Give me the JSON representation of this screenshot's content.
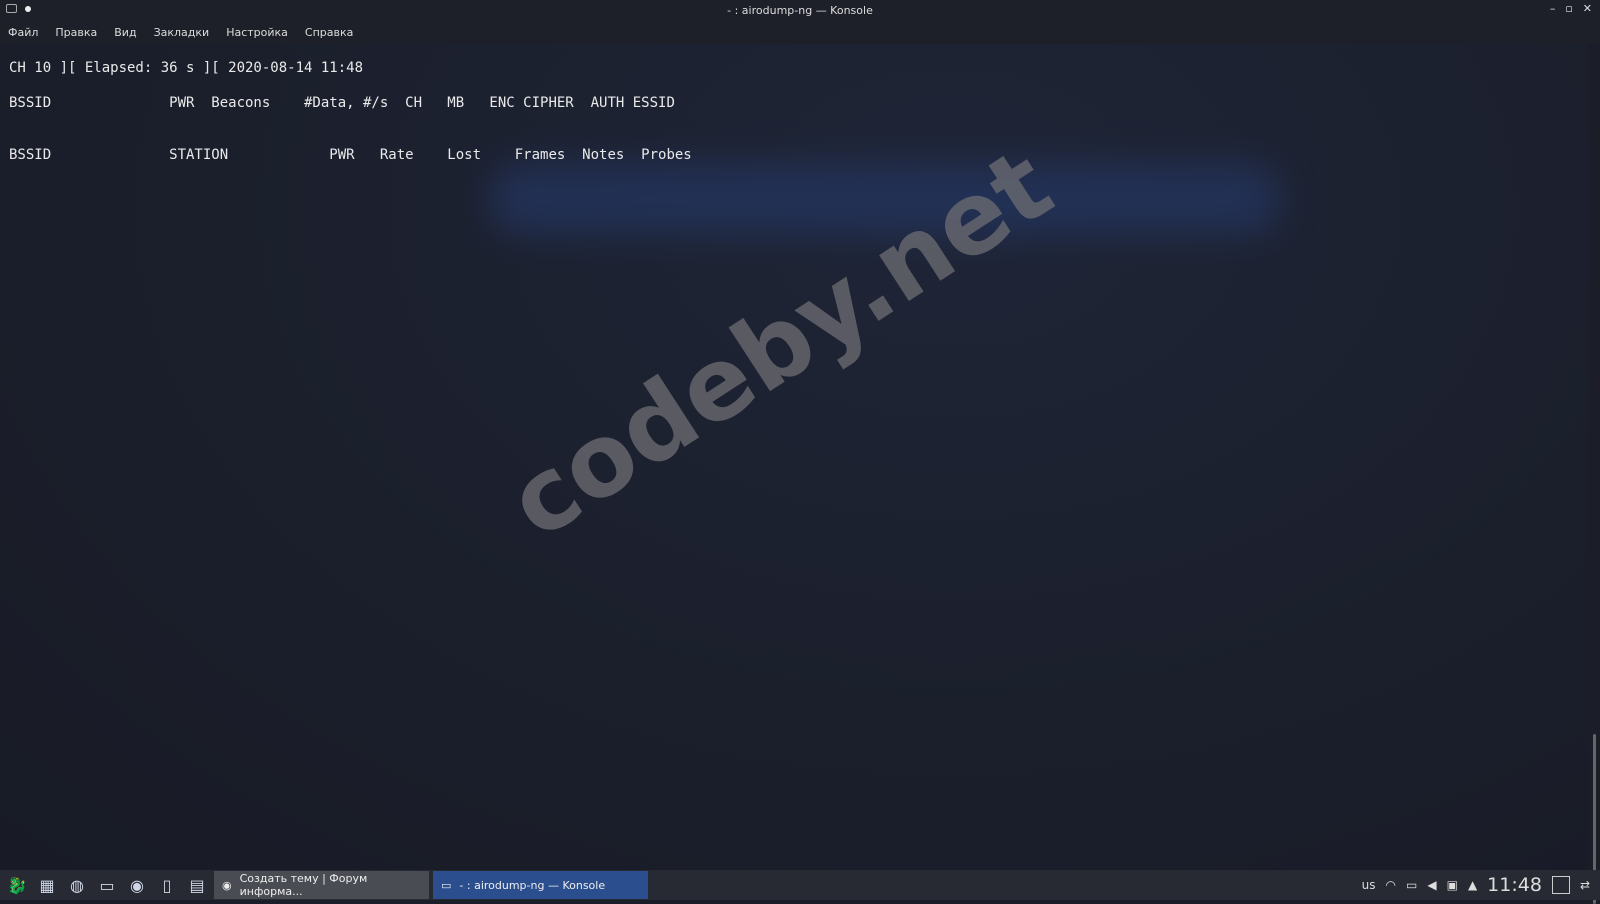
{
  "window": {
    "title": "- : airodump-ng — Konsole",
    "controls": [
      "–",
      "▫",
      "✕"
    ]
  },
  "menu": [
    "Файл",
    "Правка",
    "Вид",
    "Закладки",
    "Настройка",
    "Справка"
  ],
  "terminal": {
    "status": "CH 10 ][ Elapsed: 36 s ][ 2020-08-14 11:48",
    "ap_header": "BSSID              PWR  Beacons    #Data, #/s  CH   MB   ENC CIPHER  AUTH ESSID",
    "station_header": "BSSID              STATION            PWR   Rate    Lost    Frames  Notes  Probes"
  },
  "watermark": "codeby.net",
  "taskbar": {
    "tasks": [
      {
        "label": "Создать тему | Форум информа..."
      },
      {
        "label": "- : airodump-ng — Konsole"
      }
    ],
    "keyboard_layout": "us",
    "clock": "11:48"
  }
}
